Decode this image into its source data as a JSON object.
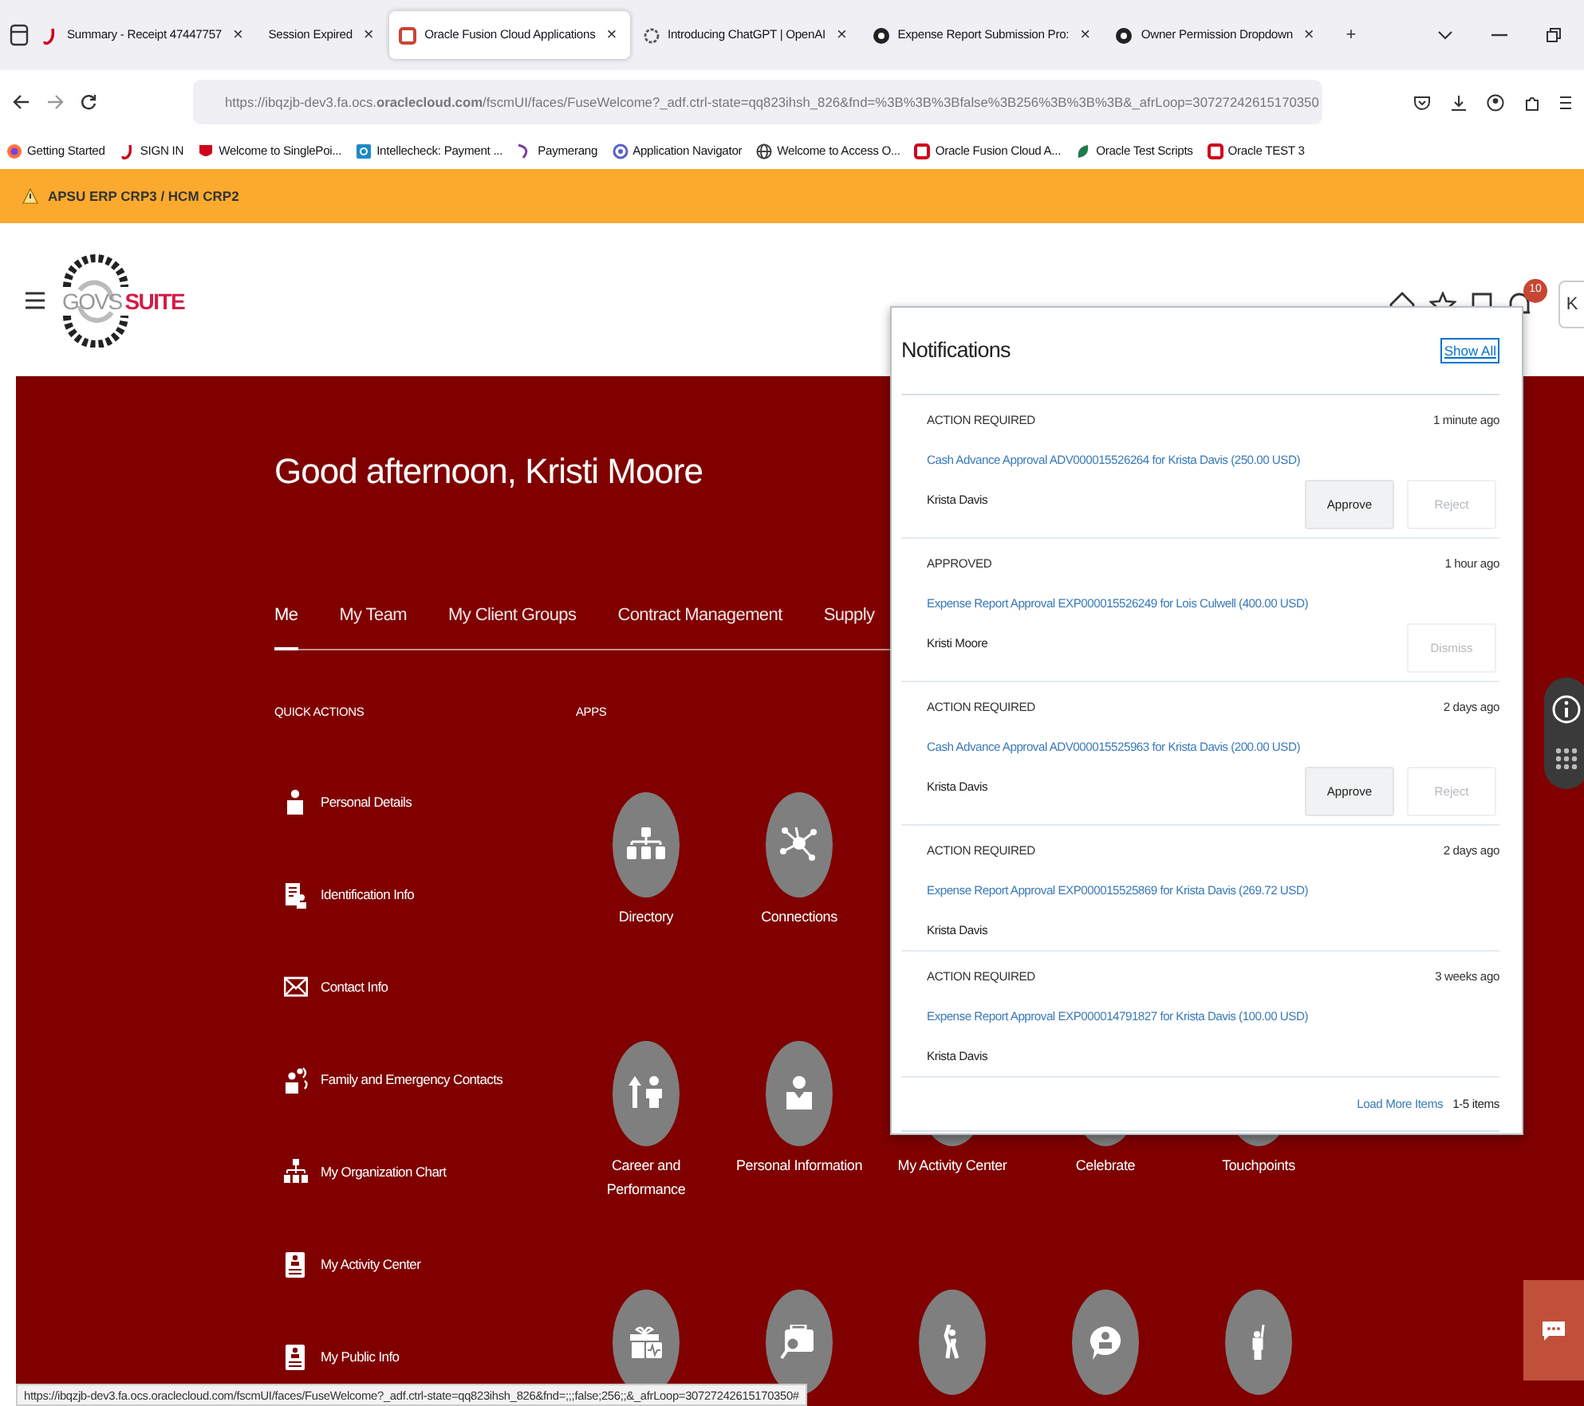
{
  "browser": {
    "tabs": [
      {
        "title": "Summary - Receipt 47447757",
        "selected": false
      },
      {
        "title": "Session Expired",
        "selected": false
      },
      {
        "title": "Oracle Fusion Cloud Applications",
        "selected": true
      },
      {
        "title": "Introducing ChatGPT | OpenAI",
        "selected": false
      },
      {
        "title": "Expense Report Submission Pro:",
        "selected": false
      },
      {
        "title": "Owner Permission Dropdown",
        "selected": false
      }
    ],
    "close_mark": "×",
    "new_tab": "+",
    "url": "https://ibqzjb-dev3.fa.ocs.**oraclecloud.com**/fscmUI/faces/FuseWelcome?_adf.ctrl-state=qq823ihsh_826&fnd=%3B%3B%3Bfalse%3B256%3B%3B%3B&_afrLoop=30727242615170350",
    "bookmarks": [
      {
        "label": "Getting Started"
      },
      {
        "label": "SIGN IN"
      },
      {
        "label": "Welcome to SinglePoi..."
      },
      {
        "label": "Intellecheck: Payment ..."
      },
      {
        "label": "Paymerang"
      },
      {
        "label": "Application Navigator"
      },
      {
        "label": "Welcome to Access O..."
      },
      {
        "label": "Oracle Fusion Cloud A..."
      },
      {
        "label": "Oracle Test Scripts"
      },
      {
        "label": "Oracle TEST 3"
      }
    ],
    "status_url": "https://ibqzjb-dev3.fa.ocs.oraclecloud.com/fscmUI/faces/FuseWelcome?_adf.ctrl-state=qq823ihsh_826&fnd=;;;false;256;;&_afrLoop=30727242615170350#"
  },
  "banner": {
    "text": "APSU ERP CRP3 / HCM CRP2"
  },
  "header": {
    "logo_left": "GOVS",
    "logo_right": "SUITE",
    "notification_count": "10",
    "user_initials": "K"
  },
  "greeting": "Good afternoon, Kristi Moore",
  "nav_tabs": [
    {
      "label": "Me",
      "selected": true
    },
    {
      "label": "My Team",
      "selected": false
    },
    {
      "label": "My Client Groups",
      "selected": false
    },
    {
      "label": "Contract Management",
      "selected": false
    },
    {
      "label": "Supply",
      "selected": false
    }
  ],
  "quick_actions": {
    "heading": "QUICK ACTIONS",
    "items": [
      {
        "label": "Personal Details"
      },
      {
        "label": "Identification Info"
      },
      {
        "label": "Contact Info"
      },
      {
        "label": "Family and Emergency Contacts"
      },
      {
        "label": "My Organization Chart"
      },
      {
        "label": "My Activity Center"
      },
      {
        "label": "My Public Info"
      }
    ]
  },
  "apps": {
    "heading": "APPS",
    "rows": [
      [
        {
          "label": "Directory"
        },
        {
          "label": "Connections"
        }
      ],
      [
        {
          "label": "Career and Performance"
        },
        {
          "label": "Personal Information"
        },
        {
          "label": "My Activity Center"
        },
        {
          "label": "Celebrate"
        },
        {
          "label": "Touchpoints"
        }
      ],
      [
        {},
        {},
        {},
        {},
        {}
      ]
    ]
  },
  "notifications": {
    "title": "Notifications",
    "show_all": "Show All",
    "items": [
      {
        "status": "ACTION REQUIRED",
        "time": "1 minute ago",
        "link": "Cash Advance Approval ADV000015526264 for Krista Davis (250.00 USD)",
        "person": "Krista Davis",
        "buttons": [
          {
            "label": "Approve",
            "disabled": false
          },
          {
            "label": "Reject",
            "disabled": true
          }
        ]
      },
      {
        "status": "APPROVED",
        "time": "1 hour ago",
        "link": "Expense Report Approval EXP000015526249 for Lois Culwell (400.00 USD)",
        "person": "Kristi Moore",
        "buttons": [
          {
            "label": "Dismiss",
            "disabled": true
          }
        ]
      },
      {
        "status": "ACTION REQUIRED",
        "time": "2 days ago",
        "link": "Cash Advance Approval ADV000015525963 for Krista Davis (200.00 USD)",
        "person": "Krista Davis",
        "buttons": [
          {
            "label": "Approve",
            "disabled": false
          },
          {
            "label": "Reject",
            "disabled": true
          }
        ]
      },
      {
        "status": "ACTION REQUIRED",
        "time": "2 days ago",
        "link": "Expense Report Approval EXP000015525869 for Krista Davis (269.72 USD)",
        "person": "Krista Davis"
      },
      {
        "status": "ACTION REQUIRED",
        "time": "3 weeks ago",
        "link": "Expense Report Approval EXP000014791827 for Krista Davis (100.00 USD)",
        "person": "Krista Davis"
      }
    ],
    "load_more": "Load More Items",
    "count": "1-5 items"
  }
}
